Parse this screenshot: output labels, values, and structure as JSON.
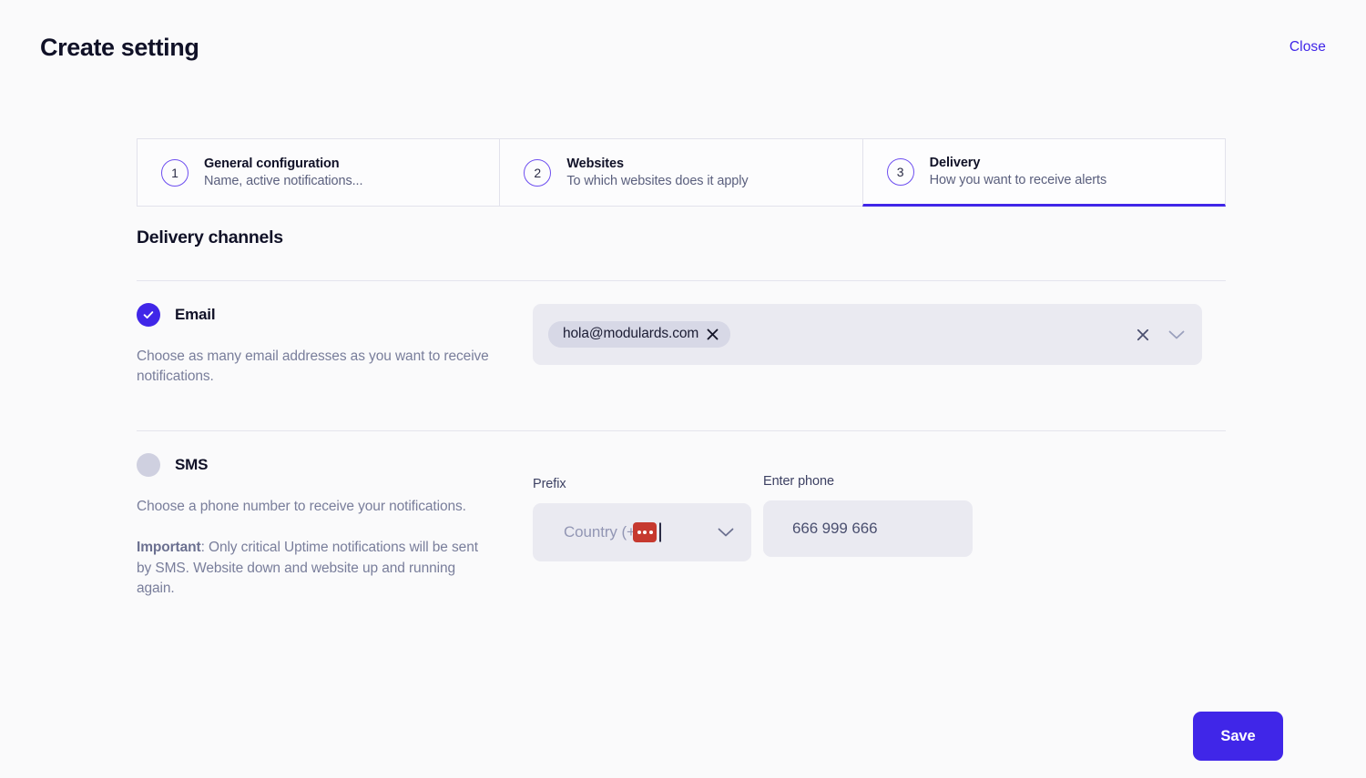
{
  "header": {
    "title": "Create setting",
    "close_label": "Close"
  },
  "stepper": {
    "steps": [
      {
        "number": "1",
        "title": "General configuration",
        "subtitle": "Name, active notifications...",
        "active": false
      },
      {
        "number": "2",
        "title": "Websites",
        "subtitle": "To which websites does it apply",
        "active": false
      },
      {
        "number": "3",
        "title": "Delivery",
        "subtitle": "How you want to receive alerts",
        "active": true
      }
    ]
  },
  "main": {
    "section_title": "Delivery channels",
    "email": {
      "label": "Email",
      "enabled": true,
      "help_text": "Choose as many email addresses as you want to receive notifications.",
      "chips": [
        {
          "value": "hola@modulards.com"
        }
      ],
      "clear_icon": "close-icon",
      "dropdown_icon": "chevron-down-icon"
    },
    "sms": {
      "label": "SMS",
      "enabled": false,
      "help_text": "Choose a phone number to receive your notifications.",
      "note_lead": "Important",
      "note_text": ": Only critical Uptime notifications will be sent by SMS. Website down and website up and running again.",
      "prefix": {
        "label": "Prefix",
        "placeholder": "Country (+00",
        "value": "",
        "masked_indicator": "masked-dots-badge",
        "dropdown_icon": "chevron-down-icon"
      },
      "phone": {
        "label": "Enter phone",
        "placeholder": "666 999 666",
        "value": ""
      }
    }
  },
  "footer": {
    "save_label": "Save"
  },
  "colors": {
    "accent": "#4026e8",
    "accent_light": "#6d4ef0",
    "field_bg": "#eaeaf1",
    "chip_bg": "#d7d8e6",
    "page_bg": "#fafafb",
    "muted_text": "#797e9b",
    "dark_text": "#101127",
    "danger": "#c6392f",
    "toggle_off": "#cfd0e0"
  }
}
